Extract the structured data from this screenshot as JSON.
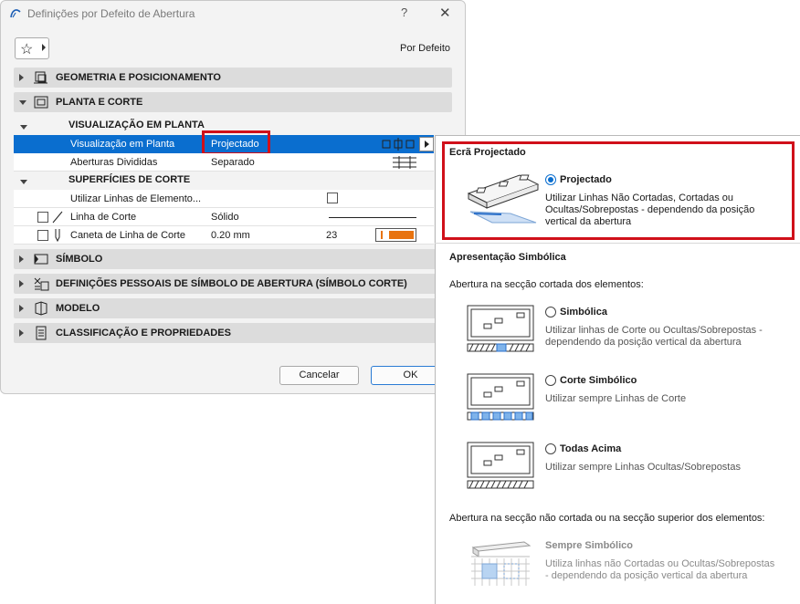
{
  "dialog": {
    "title": "Definições por Defeito de Abertura",
    "help": "?",
    "close": "✕",
    "preset": "Por Defeito",
    "favorites_icon": "star-icon"
  },
  "sections": [
    {
      "label": "GEOMETRIA E POSICIONAMENTO",
      "expanded": false
    },
    {
      "label": "PLANTA E CORTE",
      "expanded": true
    },
    {
      "label": "SÍMBOLO",
      "expanded": false
    },
    {
      "label": "DEFINIÇÕES PESSOAIS DE SÍMBOLO DE ABERTURA (SÍMBOLO CORTE)",
      "expanded": false
    },
    {
      "label": "MODELO",
      "expanded": false
    },
    {
      "label": "CLASSIFICAÇÃO E PROPRIEDADES",
      "expanded": false
    }
  ],
  "plan": {
    "sub1": "VISUALIZAÇÃO EM PLANTA",
    "rows1": [
      {
        "name": "Visualização em Planta",
        "value": "Projectado",
        "selected": true
      },
      {
        "name": "Aberturas Divididas",
        "value": "Separado"
      }
    ],
    "sub2": "SUPERFÍCIES DE CORTE",
    "rows2": [
      {
        "name": "Utilizar Linhas de Elemento...",
        "value": ""
      },
      {
        "name": "Linha de Corte",
        "value": "Sólido"
      },
      {
        "name": "Caneta de Linha de Corte",
        "value": "0.20 mm",
        "pen": "23"
      }
    ]
  },
  "buttons": {
    "cancel": "Cancelar",
    "ok": "OK"
  },
  "popup": {
    "screen_title": "Ecrã Projectado",
    "projected": {
      "label": "Projectado",
      "desc": "Utilizar Linhas Não Cortadas, Cortadas ou Ocultas/Sobrepostas - dependendo da posição vertical da abertura"
    },
    "symbolic_title": "Apresentação Simbólica",
    "cut_caption": "Abertura na secção cortada dos elementos:",
    "options": [
      {
        "label": "Simbólica",
        "desc": "Utilizar linhas de Corte ou Ocultas/Sobrepostas - dependendo da posição vertical da abertura"
      },
      {
        "label": "Corte Simbólico",
        "desc": "Utilizar sempre Linhas de Corte"
      },
      {
        "label": "Todas Acima",
        "desc": "Utilizar sempre Linhas Ocultas/Sobrepostas"
      }
    ],
    "uncut_caption": "Abertura na secção não cortada ou na secção superior dos elementos:",
    "always": {
      "label": "Sempre Simbólico",
      "desc": "Utiliza linhas não Cortadas ou Ocultas/Sobrepostas - dependendo da posição vertical da abertura"
    }
  },
  "colors": {
    "selection": "#0a6ecf",
    "highlight": "#d0101a",
    "pen": "#e8730f"
  }
}
